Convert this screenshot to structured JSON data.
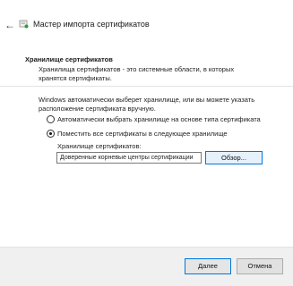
{
  "window": {
    "title": "Мастер импорта сертификатов",
    "back_icon": "back-arrow-icon",
    "wizard_icon": "certificate-wizard-icon"
  },
  "header": {
    "section_title": "Хранилище сертификатов",
    "section_description": "Хранилища сертификатов - это системные области, в которых хранятся сертификаты."
  },
  "content": {
    "intro": "Windows автоматически выберет хранилище, или вы можете указать расположение сертификата вручную.",
    "options": [
      {
        "label": "Автоматически выбрать хранилище на основе типа сертификата",
        "checked": false
      },
      {
        "label": "Поместить все сертификаты в следующее хранилище",
        "checked": true
      }
    ],
    "store_label": "Хранилище сертификатов:",
    "store_value": "Доверенные корневые центры сертификации",
    "browse_button": "Обзор..."
  },
  "footer": {
    "next_button": "Далее",
    "cancel_button": "Отмена"
  },
  "colors": {
    "accent": "#0078d7",
    "footer_bg": "#f0f0f0"
  }
}
